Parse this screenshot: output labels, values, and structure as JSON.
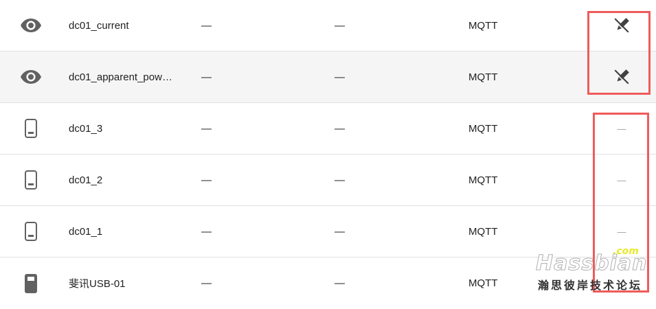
{
  "rows": [
    {
      "name": "dc01_current",
      "col2": "—",
      "col3": "—",
      "integration": "MQTT",
      "icon": "eye-icon",
      "action": "edit-off-icon"
    },
    {
      "name": "dc01_apparent_pow…",
      "col2": "—",
      "col3": "—",
      "integration": "MQTT",
      "icon": "eye-icon",
      "action": "edit-off-icon"
    },
    {
      "name": "dc01_3",
      "col2": "—",
      "col3": "—",
      "integration": "MQTT",
      "icon": "phone-icon",
      "action": "—"
    },
    {
      "name": "dc01_2",
      "col2": "—",
      "col3": "—",
      "integration": "MQTT",
      "icon": "phone-icon",
      "action": "—"
    },
    {
      "name": "dc01_1",
      "col2": "—",
      "col3": "—",
      "integration": "MQTT",
      "icon": "phone-icon",
      "action": "—"
    },
    {
      "name": "斐讯USB-01",
      "col2": "—",
      "col3": "—",
      "integration": "MQTT",
      "icon": "usb-device-icon",
      "action": ""
    }
  ],
  "watermark": {
    "com": ".com",
    "main": "Hassbian",
    "cn": "瀚思彼岸技术论坛"
  },
  "colors": {
    "highlight_row": "#f5f5f5",
    "annotation_red": "#f05a5a",
    "icon_gray": "#616161"
  }
}
